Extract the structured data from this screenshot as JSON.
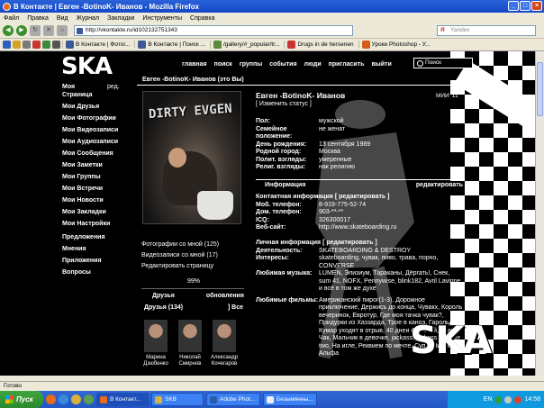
{
  "window": {
    "title": "В Контакте | Евген -BotinoK- Иванов - Mozilla Firefox"
  },
  "menu": [
    "Файл",
    "Правка",
    "Вид",
    "Журнал",
    "Закладки",
    "Инструменты",
    "Справка"
  ],
  "nav": {
    "url": "http://vkontakte.ru/id102132751343",
    "search_placeholder": "Yandex"
  },
  "bookmarks": [
    "В Контакте | Фотог...",
    "В Контакте | Поиск ...",
    "/gallery/#_popular/tr...",
    "Drugs in de hersenen",
    "Уроки Photoshop - У..."
  ],
  "site": {
    "logo": "SKA",
    "topnav": [
      "главная",
      "поиск",
      "группы",
      "события",
      "люди",
      "пригласить",
      "выйти"
    ],
    "search_label": "Поиск",
    "leftnav": [
      "Моя Страница",
      "Мои Друзья",
      "Мои Фотографии",
      "Мои Видеозаписи",
      "Мои Аудиозаписи",
      "Мои Сообщения",
      "Мои Заметки",
      "Мои Группы",
      "Мои Встречи",
      "Мои Новости",
      "Мои Закладки",
      "Мои Настройки",
      "Предложения",
      "Мнения",
      "Приложения",
      "Вопросы"
    ],
    "leftnav_edit": "ред."
  },
  "profile": {
    "header": "Евген -BotinoK- Иванов (это Вы)",
    "photo_text": "DIRTY EVGEN",
    "photos_with_me": "Фотографии со мной (125)",
    "videos_with_me": "Видеозаписи со мной (17)",
    "edit_page": "Редактировать страницу",
    "percent": "99%",
    "friends_label": "Друзья",
    "friends_updates": "обновления",
    "friends_count": "Друзья (134)",
    "friends_all": "Все",
    "friends": [
      {
        "first": "Марина",
        "last": "Дзюбенко"
      },
      {
        "first": "Николай",
        "last": "Смирнов"
      },
      {
        "first": "Александр",
        "last": "Кочегаров"
      }
    ],
    "name": "Евген -BotinoK- Иванов",
    "school": "МИИ '11",
    "change_status": "[ Изменить статус ]",
    "basic": [
      {
        "k": "Пол:",
        "v": "мужской"
      },
      {
        "k": "Семейное положение:",
        "v": "не женат"
      },
      {
        "k": "День рождения:",
        "v": "13 сентября 1989"
      },
      {
        "k": "Родной город:",
        "v": "Москва"
      },
      {
        "k": "Полит. взгляды:",
        "v": "умеренные"
      },
      {
        "k": "Религ. взгляды:",
        "v": "нак религию"
      }
    ],
    "info_title": "Информация",
    "info_edit": "редактировать",
    "contact_title": "Контактная информация",
    "contact_edit": "[ редактировать ]",
    "contact": [
      {
        "k": "Моб. телефон:",
        "v": "8-919-775-52-74"
      },
      {
        "k": "Дом. телефон:",
        "v": "903-**-**"
      },
      {
        "k": "ICQ:",
        "v": "326300017"
      },
      {
        "k": "Веб-сайт:",
        "v": "http://www.skateboarding.ru"
      }
    ],
    "personal_title": "Личная информация",
    "personal_edit": "[ редактировать ]",
    "personal": [
      {
        "k": "Деятельность:",
        "v": "SKATEBOARDING & DESTROY"
      },
      {
        "k": "Интересы:",
        "v": "skateboarding, чувак, пиво, трава, порно, CONVERSE"
      },
      {
        "k": "Любимая музыка:",
        "v": "LUMEN, Элизиум, Тараканы, Дёргать!, Снек, sum 41, NOFX, Pennywise, blink182, Avril Lavigne, и всё в том же духе"
      },
      {
        "k": "Любимые фильмы:",
        "v": "Американский пирог(1-3), Дорожное приключение, Держись до конца, Чувакх, Король вечеринок, Евротур, Где моя тачка чувак?, Придурки из Хаззарда, Трое в каноэ, Гарольд и Кумар уходят в отрыв, 40 днеи 40 ночей, Удачи Чак, Мальчик в девочке, jackass, jackass number two, На игле, Реквием по мечте, Суп о Ниося, Альфа"
      }
    ],
    "shirt_logo": "SKA"
  },
  "status_bar": "Готово",
  "taskbar": {
    "start": "Пуск",
    "tasks": [
      "В Контакт...",
      "SKB",
      "Adobe Phot...",
      "Безымянны..."
    ],
    "lang": "EN",
    "clock": "14:58"
  },
  "colors": {
    "titlebar": "#1347c8",
    "page_bg": "#000000",
    "taskbar": "#2456c5",
    "start": "#2d8a2d"
  }
}
